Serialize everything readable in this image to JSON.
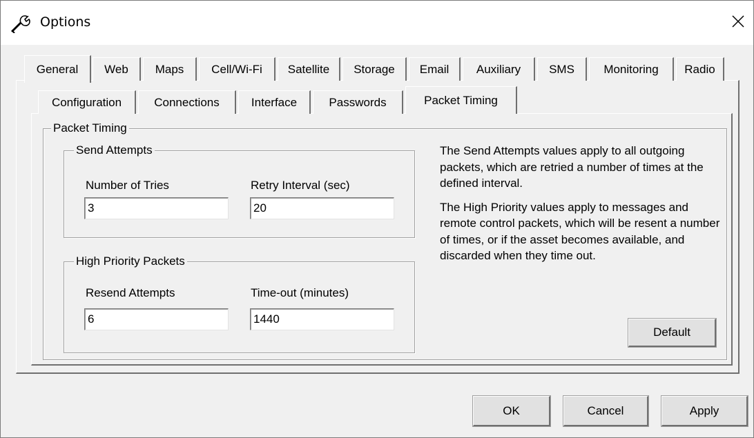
{
  "window": {
    "title": "Options"
  },
  "main_tabs": [
    {
      "label": "General",
      "active": true
    },
    {
      "label": "Web"
    },
    {
      "label": "Maps"
    },
    {
      "label": "Cell/Wi-Fi"
    },
    {
      "label": "Satellite"
    },
    {
      "label": "Storage"
    },
    {
      "label": "Email"
    },
    {
      "label": "Auxiliary"
    },
    {
      "label": "SMS"
    },
    {
      "label": "Monitoring"
    },
    {
      "label": "Radio"
    }
  ],
  "sub_tabs": [
    {
      "label": "Configuration"
    },
    {
      "label": "Connections"
    },
    {
      "label": "Interface"
    },
    {
      "label": "Passwords"
    },
    {
      "label": "Packet Timing",
      "active": true
    }
  ],
  "packet_timing": {
    "group_label": "Packet Timing",
    "send_attempts": {
      "label": "Send Attempts",
      "tries_label": "Number of Tries",
      "tries_value": "3",
      "interval_label": "Retry Interval (sec)",
      "interval_value": "20"
    },
    "high_priority": {
      "label": "High Priority Packets",
      "resend_label": "Resend Attempts",
      "resend_value": "6",
      "timeout_label": "Time-out (minutes)",
      "timeout_value": "1440"
    },
    "info_send": "The Send Attempts values apply to all outgoing packets, which are retried a number of times at the defined interval.",
    "info_priority": "The High Priority values apply to messages and remote control packets, which will be resent a number of times, or if the asset becomes available, and discarded when they time out.",
    "default_button": "Default"
  },
  "footer": {
    "ok": "OK",
    "cancel": "Cancel",
    "apply": "Apply"
  },
  "icons": {
    "title_icon": "wrench-icon",
    "close_icon": "close-icon"
  }
}
